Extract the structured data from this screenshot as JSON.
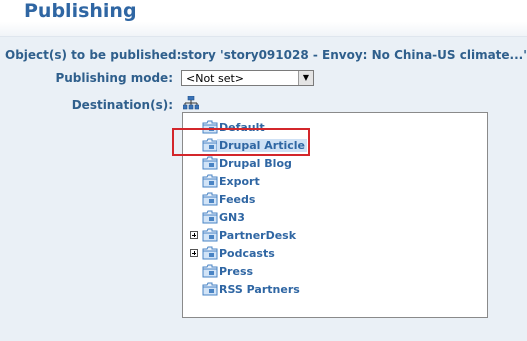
{
  "page": {
    "title": "Publishing"
  },
  "form": {
    "objects_label": "Object(s) to be published:",
    "objects_value": "story 'story091028 - Envoy: No China-US climate...'",
    "mode_label": "Publishing mode:",
    "mode_selected": "<Not set>",
    "dest_label": "Destination(s):"
  },
  "tree": {
    "items": [
      {
        "label": "Default",
        "expandable": false,
        "selected": false
      },
      {
        "label": "Drupal Article",
        "expandable": false,
        "selected": true
      },
      {
        "label": "Drupal Blog",
        "expandable": false,
        "selected": false
      },
      {
        "label": "Export",
        "expandable": false,
        "selected": false
      },
      {
        "label": "Feeds",
        "expandable": false,
        "selected": false
      },
      {
        "label": "GN3",
        "expandable": false,
        "selected": false
      },
      {
        "label": "PartnerDesk",
        "expandable": true,
        "selected": false
      },
      {
        "label": "Podcasts",
        "expandable": true,
        "selected": false
      },
      {
        "label": "Press",
        "expandable": false,
        "selected": false
      },
      {
        "label": "RSS Partners",
        "expandable": false,
        "selected": false
      }
    ]
  },
  "colors": {
    "accent": "#2f66a3",
    "highlight": "#d3262b",
    "background": "#eaf0f6"
  },
  "icons": {
    "folder": "folder-icon",
    "destinations": "network-tree-icon",
    "expand": "plus-expander-icon"
  }
}
